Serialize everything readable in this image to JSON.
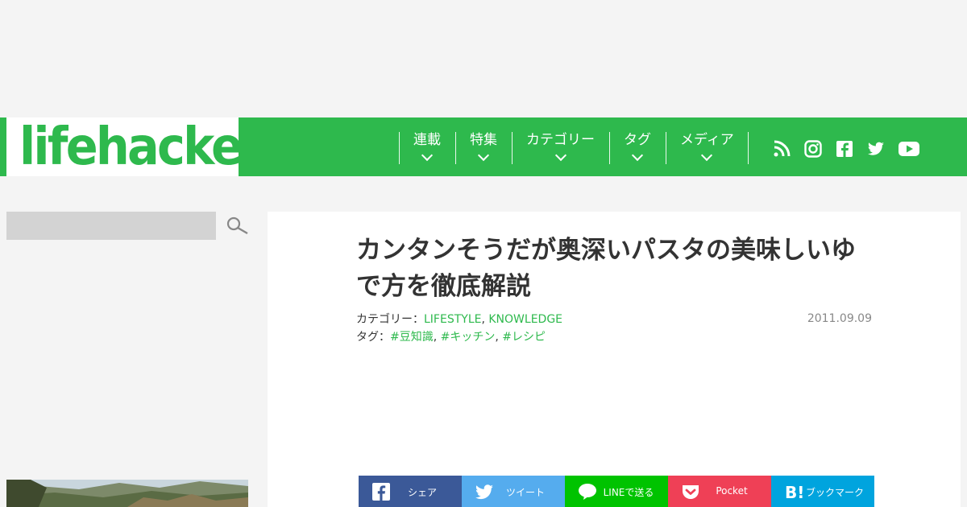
{
  "brand": {
    "logo_text": "lifehacker",
    "color": "#2eb94d"
  },
  "nav": {
    "items": [
      {
        "label": "連載"
      },
      {
        "label": "特集"
      },
      {
        "label": "カテゴリー"
      },
      {
        "label": "タグ"
      },
      {
        "label": "メディア"
      }
    ],
    "social_icons": [
      "rss-icon",
      "instagram-icon",
      "facebook-icon",
      "twitter-icon",
      "youtube-icon"
    ]
  },
  "search": {
    "value": "",
    "placeholder": ""
  },
  "article": {
    "title": "カンタンそうだが奥深いパスタの美味しいゆで方を徹底解説",
    "category_label": "カテゴリー：",
    "categories": [
      "LIFESTYLE",
      "KNOWLEDGE"
    ],
    "tag_label": "タグ：",
    "tags": [
      "#豆知識",
      "#キッチン",
      "#レシピ"
    ],
    "separator": ",",
    "date": "2011.09.09"
  },
  "share": {
    "buttons": [
      {
        "label": "シェア",
        "icon": "facebook-icon",
        "color": "#3b5998"
      },
      {
        "label": "ツイート",
        "icon": "twitter-icon",
        "color": "#55acee"
      },
      {
        "label": "LINEで送る",
        "icon": "line-icon",
        "color": "#00c300"
      },
      {
        "label": "Pocket",
        "icon": "pocket-icon",
        "color": "#ef4056"
      },
      {
        "label": "ブックマーク",
        "icon": "hatena-icon",
        "color": "#00a4de"
      }
    ]
  }
}
